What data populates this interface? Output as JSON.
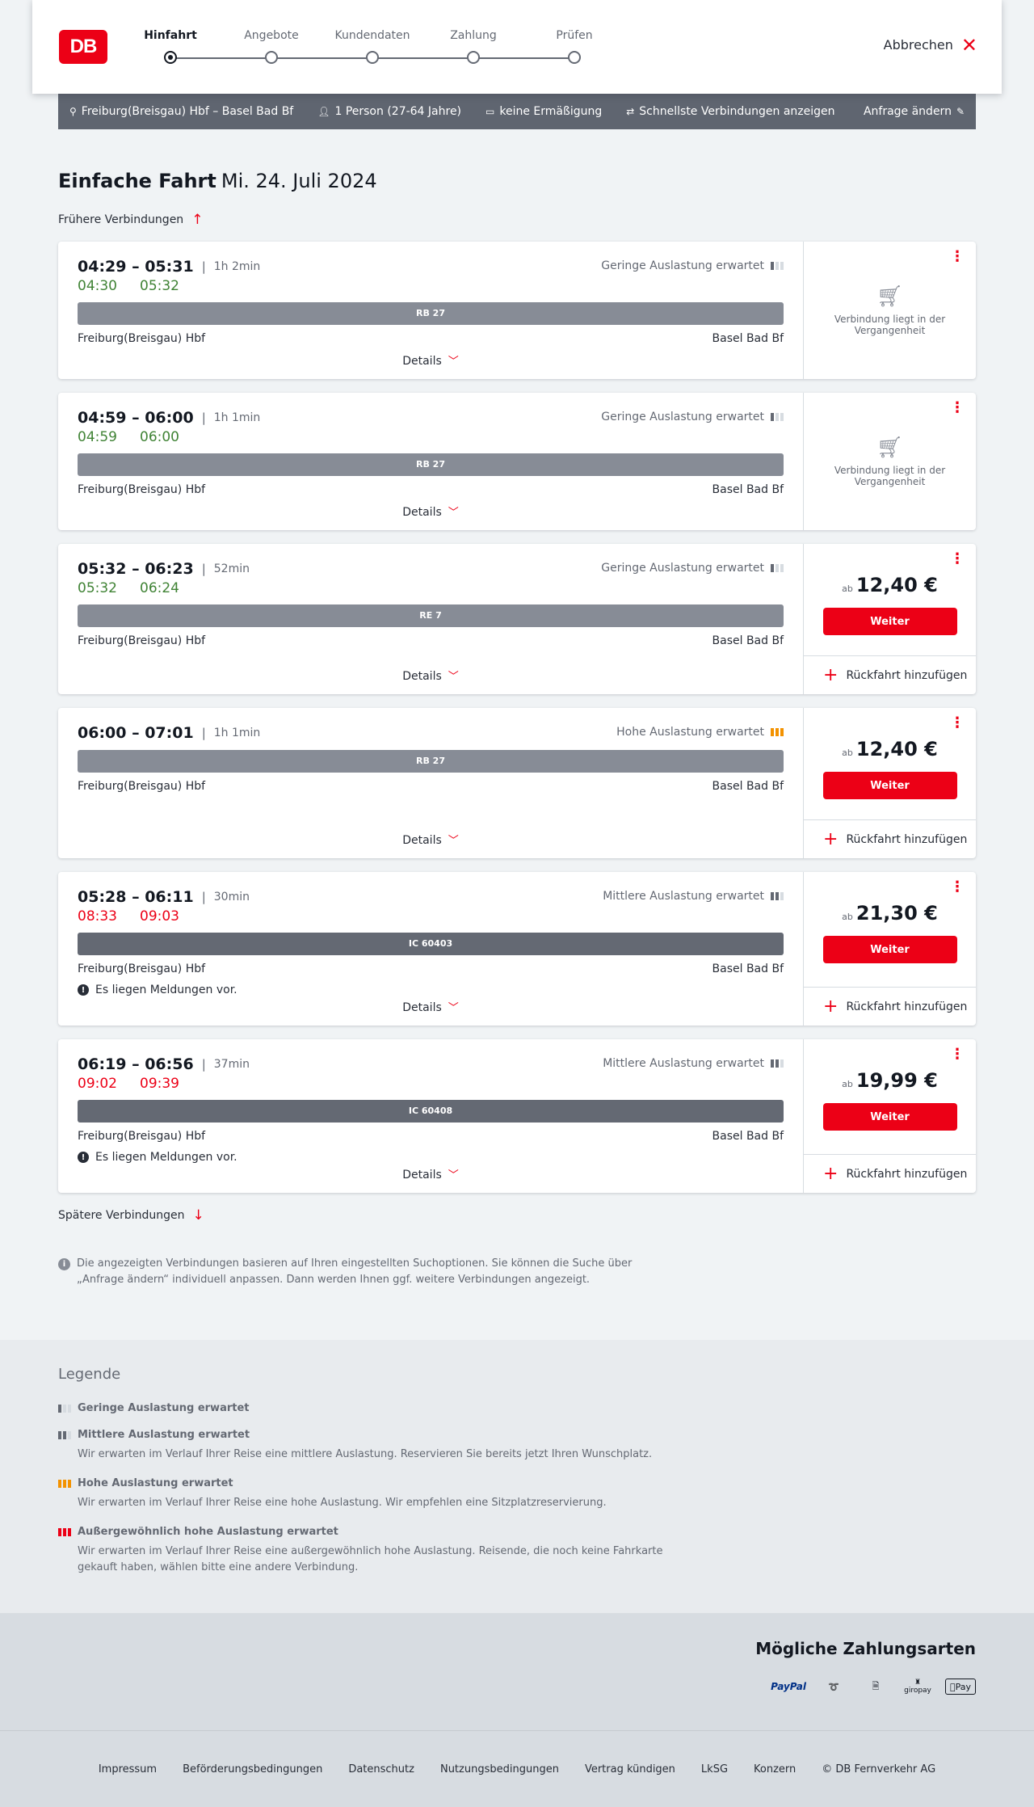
{
  "header": {
    "logo_text": "DB",
    "steps": [
      "Hinfahrt",
      "Angebote",
      "Kundendaten",
      "Zahlung",
      "Prüfen"
    ],
    "active_step": 0,
    "abort_label": "Abbrechen"
  },
  "search_bar": {
    "route": "Freiburg(Breisgau) Hbf – Basel Bad Bf",
    "passengers": "1 Person (27-64 Jahre)",
    "discount": "keine Ermäßigung",
    "fastest": "Schnellste Verbindungen anzeigen",
    "change": "Anfrage ändern"
  },
  "main": {
    "title": "Einfache Fahrt",
    "date": "Mi. 24. Juli 2024",
    "earlier": "Frühere Verbindungen",
    "later": "Spätere Verbindungen",
    "details_label": "Details",
    "price_prefix": "ab",
    "continue_label": "Weiter",
    "return_label": "Rückfahrt hinzufügen",
    "past_label": "Verbindung liegt in der Vergangenheit",
    "info": "Die angezeigten Verbindungen basieren auf Ihren eingestellten Suchoptionen. Sie können die Suche über „Anfrage ändern“ individuell anpassen. Dann werden Ihnen ggf. weitere Verbindungen angezeigt."
  },
  "connections": [
    {
      "times": "04:29 – 05:31",
      "duration": "1h 2min",
      "rt_dep": "04:30",
      "rt_arr": "05:32",
      "rt_color": "green",
      "occupancy": "Geringe Auslastung erwartet",
      "occ_level": 1,
      "train": "RB 27",
      "from": "Freiburg(Breisgau) Hbf",
      "to": "Basel Bad Bf",
      "message": "",
      "past": true,
      "price": ""
    },
    {
      "times": "04:59 – 06:00",
      "duration": "1h 1min",
      "rt_dep": "04:59",
      "rt_arr": "06:00",
      "rt_color": "green",
      "occupancy": "Geringe Auslastung erwartet",
      "occ_level": 1,
      "train": "RB 27",
      "from": "Freiburg(Breisgau) Hbf",
      "to": "Basel Bad Bf",
      "message": "",
      "past": true,
      "price": ""
    },
    {
      "times": "05:32 – 06:23",
      "duration": "52min",
      "rt_dep": "05:32",
      "rt_arr": "06:24",
      "rt_color": "green",
      "occupancy": "Geringe Auslastung erwartet",
      "occ_level": 1,
      "train": "RE 7",
      "from": "Freiburg(Breisgau) Hbf",
      "to": "Basel Bad Bf",
      "message": "",
      "past": false,
      "price": "12,40 €"
    },
    {
      "times": "06:00 – 07:01",
      "duration": "1h 1min",
      "rt_dep": "",
      "rt_arr": "",
      "rt_color": "",
      "occupancy": "Hohe Auslastung erwartet",
      "occ_level": 3,
      "train": "RB 27",
      "from": "Freiburg(Breisgau) Hbf",
      "to": "Basel Bad Bf",
      "message": "",
      "past": false,
      "price": "12,40 €"
    },
    {
      "times": "05:28 – 06:11",
      "duration": "30min",
      "rt_dep": "08:33",
      "rt_arr": "09:03",
      "rt_color": "red",
      "occupancy": "Mittlere Auslastung erwartet",
      "occ_level": 2,
      "train": "IC 60403",
      "from": "Freiburg(Breisgau) Hbf",
      "to": "Basel Bad Bf",
      "message": "Es liegen Meldungen vor.",
      "past": false,
      "price": "21,30 €"
    },
    {
      "times": "06:19 – 06:56",
      "duration": "37min",
      "rt_dep": "09:02",
      "rt_arr": "09:39",
      "rt_color": "red",
      "occupancy": "Mittlere Auslastung erwartet",
      "occ_level": 2,
      "train": "IC 60408",
      "from": "Freiburg(Breisgau) Hbf",
      "to": "Basel Bad Bf",
      "message": "Es liegen Meldungen vor.",
      "past": false,
      "price": "19,99 €"
    }
  ],
  "legend": {
    "title": "Legende",
    "items": [
      {
        "label": "Geringe Auslastung erwartet",
        "desc": "",
        "level": 1
      },
      {
        "label": "Mittlere Auslastung erwartet",
        "desc": "Wir erwarten im Verlauf Ihrer Reise eine mittlere Auslastung. Reservieren Sie bereits jetzt Ihren Wunschplatz.",
        "level": 2
      },
      {
        "label": "Hohe Auslastung erwartet",
        "desc": "Wir erwarten im Verlauf Ihrer Reise eine hohe Auslastung. Wir empfehlen eine Sitzplatzreservierung.",
        "level": 3
      },
      {
        "label": "Außergewöhnlich hohe Auslastung erwartet",
        "desc": "Wir erwarten im Verlauf Ihrer Reise eine außergewöhnlich hohe Auslastung. Reisende, die noch keine Fahrkarte gekauft haben, wählen bitte eine andere Verbindung.",
        "level": 4
      }
    ]
  },
  "payment": {
    "title": "Mögliche Zahlungsarten",
    "methods": [
      "PayPal",
      "giropay",
      "Pay"
    ]
  },
  "footer": {
    "links": [
      "Impressum",
      "Beförderungsbedingungen",
      "Datenschutz",
      "Nutzungsbedingungen",
      "Vertrag kündigen",
      "LkSG",
      "Konzern",
      "© DB Fernverkehr AG"
    ]
  },
  "colors": {
    "brand_red": "#ec0016",
    "green": "#408335",
    "high_occ": "#f39200"
  }
}
